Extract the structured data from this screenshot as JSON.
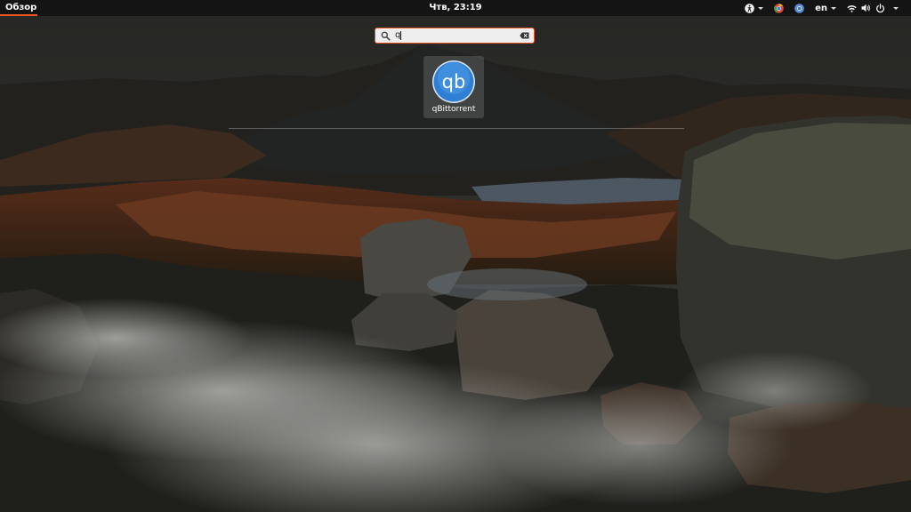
{
  "topbar": {
    "activities_label": "Обзор",
    "clock": "Чтв, 23:19",
    "language": "en",
    "accent_color": "#e95420",
    "tray_icons": [
      "accessibility-icon",
      "chromium-icon",
      "chrome-icon",
      "wifi-icon",
      "volume-icon",
      "power-icon"
    ]
  },
  "search": {
    "value": "q",
    "icon": "search-icon",
    "clear_icon": "clear-icon"
  },
  "results": [
    {
      "label": "qBittorrent",
      "icon_text": "qb",
      "icon": "qbittorrent-icon"
    }
  ]
}
